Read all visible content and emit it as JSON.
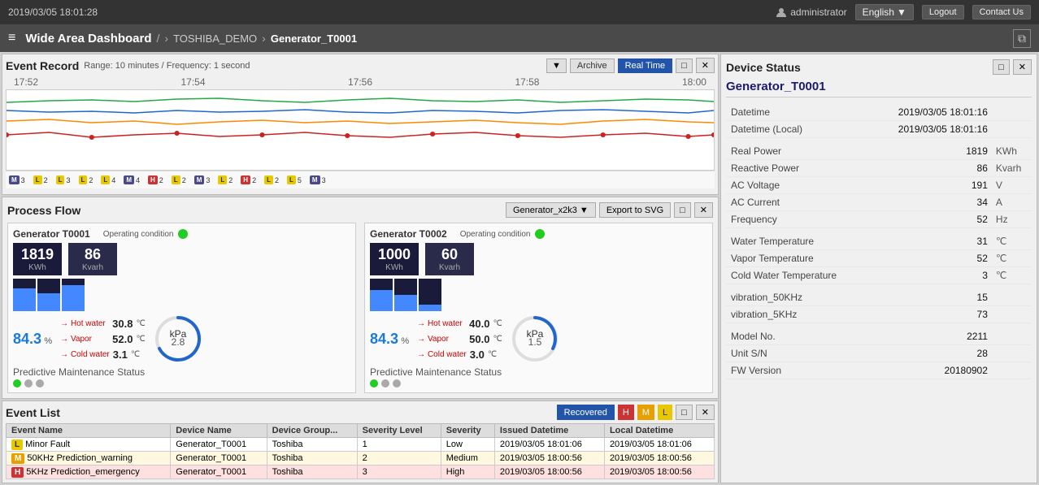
{
  "topbar": {
    "datetime": "2019/03/05 18:01:28",
    "user": "administrator",
    "lang": "English",
    "lang_arrow": "▼",
    "logout": "Logout",
    "contact": "Contact Us"
  },
  "navbar": {
    "menu_icon": "≡",
    "title": "Wide Area Dashboard",
    "sep1": "/",
    "breadcrumb1": "TOSHIBA_DEMO",
    "sep2": "›",
    "breadcrumb2": "Generator_T0001",
    "window_icon": "⧉"
  },
  "event_record": {
    "title": "Event Record",
    "range_label": "Range: 10 minutes / Frequency: 1 second",
    "dropdown": "▼",
    "archive": "Archive",
    "realtime": "Real Time",
    "minimize": "□",
    "close": "✕",
    "time_labels": [
      "17:52",
      "17:54",
      "17:56",
      "17:58",
      "18:00"
    ]
  },
  "process_flow": {
    "title": "Process Flow",
    "generator_select": "Generator_x2k3 ▼",
    "export": "Export to SVG",
    "minimize": "□",
    "close": "✕",
    "generators": [
      {
        "name": "Generator T0001",
        "condition_label": "Operating condition",
        "power_kwh": "1819",
        "power_unit": "KWh",
        "reactive_kvarh": "86",
        "reactive_unit": "Kvarh",
        "percent": "84.3",
        "percent_unit": "%",
        "hot_water_label": "Hot water",
        "hot_water_value": "30.8",
        "hot_water_unit": "℃",
        "vapor_label": "Vapor",
        "vapor_value": "52.0",
        "vapor_unit": "℃",
        "cold_water_label": "Cold water",
        "cold_water_value": "3.1",
        "cold_water_unit": "℃",
        "predictive_label": "Predictive Maintenance Status"
      },
      {
        "name": "Generator T0002",
        "condition_label": "Operating condition",
        "power_kwh": "1000",
        "power_unit": "KWh",
        "reactive_kvarh": "60",
        "reactive_unit": "Kvarh",
        "percent": "84.3",
        "percent_unit": "%",
        "hot_water_label": "Hot water",
        "hot_water_value": "40.0",
        "hot_water_unit": "℃",
        "vapor_label": "Vapor",
        "vapor_value": "50.0",
        "vapor_unit": "℃",
        "cold_water_label": "Cold water",
        "cold_water_value": "3.0",
        "cold_water_unit": "℃",
        "predictive_label": "Predictive Maintenance Status"
      }
    ]
  },
  "event_list": {
    "title": "Event List",
    "recovered_btn": "Recovered",
    "h_btn": "H",
    "m_btn": "M",
    "l_btn": "L",
    "minimize": "□",
    "close": "✕",
    "columns": [
      "Event Name",
      "Device Name",
      "Device Group...",
      "Severity Level",
      "Severity",
      "Issued Datetime",
      "Local Datetime"
    ],
    "rows": [
      {
        "severity_badge": "L",
        "severity_class": "low",
        "event_name": "Minor Fault",
        "device_name": "Generator_T0001",
        "device_group": "Toshiba",
        "severity_level": "1",
        "severity": "Low",
        "issued": "2019/03/05 18:01:06",
        "local": "2019/03/05 18:01:06"
      },
      {
        "severity_badge": "M",
        "severity_class": "medium",
        "event_name": "50KHz Prediction_warning",
        "device_name": "Generator_T0001",
        "device_group": "Toshiba",
        "severity_level": "2",
        "severity": "Medium",
        "issued": "2019/03/05 18:00:56",
        "local": "2019/03/05 18:00:56"
      },
      {
        "severity_badge": "H",
        "severity_class": "high",
        "event_name": "5KHz Prediction_emergency",
        "device_name": "Generator_T0001",
        "device_group": "Toshiba",
        "severity_level": "3",
        "severity": "High",
        "issued": "2019/03/05 18:00:56",
        "local": "2019/03/05 18:00:56"
      }
    ]
  },
  "device_status": {
    "title": "Device Status",
    "minimize": "□",
    "close": "✕",
    "device_name": "Generator_T0001",
    "fields": [
      {
        "label": "Datetime",
        "value": "2019/03/05 18:01:16",
        "unit": ""
      },
      {
        "label": "Datetime (Local)",
        "value": "2019/03/05 18:01:16",
        "unit": ""
      },
      {
        "label": "",
        "value": "",
        "unit": ""
      },
      {
        "label": "Real Power",
        "value": "1819",
        "unit": "KWh"
      },
      {
        "label": "Reactive Power",
        "value": "86",
        "unit": "Kvarh"
      },
      {
        "label": "AC Voltage",
        "value": "191",
        "unit": "V"
      },
      {
        "label": "AC Current",
        "value": "34",
        "unit": "A"
      },
      {
        "label": "Frequency",
        "value": "52",
        "unit": "Hz"
      },
      {
        "label": "",
        "value": "",
        "unit": ""
      },
      {
        "label": "Water Temperature",
        "value": "31",
        "unit": "℃"
      },
      {
        "label": "Vapor Temperature",
        "value": "52",
        "unit": "℃"
      },
      {
        "label": "Cold Water Temperature",
        "value": "3",
        "unit": "℃"
      },
      {
        "label": "",
        "value": "",
        "unit": ""
      },
      {
        "label": "vibration_50KHz",
        "value": "15",
        "unit": ""
      },
      {
        "label": "vibration_5KHz",
        "value": "73",
        "unit": ""
      },
      {
        "label": "",
        "value": "",
        "unit": ""
      },
      {
        "label": "Model No.",
        "value": "2211",
        "unit": ""
      },
      {
        "label": "Unit S/N",
        "value": "28",
        "unit": ""
      },
      {
        "label": "FW Version",
        "value": "20180902",
        "unit": ""
      }
    ]
  }
}
